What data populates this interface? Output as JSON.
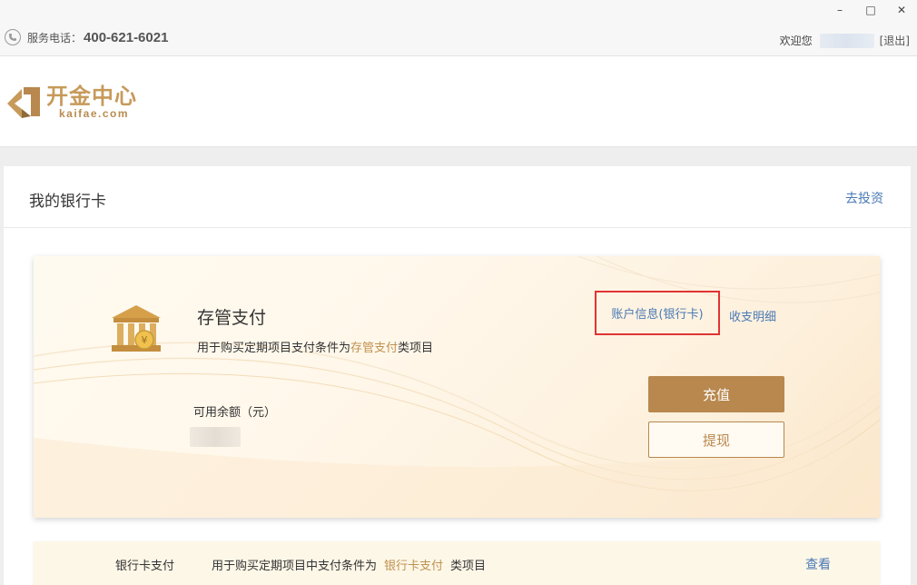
{
  "window": {
    "minimize": "–",
    "maximize": "□",
    "close": "✕"
  },
  "topbar": {
    "phone_label": "服务电话：",
    "phone_number": "400-621-6021",
    "welcome": "欢迎您",
    "logout": "[退出]"
  },
  "logo": {
    "name_cn": "开金中心",
    "name_en": "kaifae.com"
  },
  "panel": {
    "title": "我的银行卡",
    "go_invest": "去投资"
  },
  "card": {
    "title": "存管支付",
    "desc_prefix": "用于购买定期项目支付条件为",
    "desc_highlight": "存管支付",
    "desc_suffix": "类项目",
    "account_info_link": "账户信息(银行卡)",
    "detail_link": "收支明细",
    "balance_label": "可用余额（元）",
    "recharge_button": "充值",
    "withdraw_button": "提现"
  },
  "bank_row": {
    "type": "银行卡支付",
    "desc_prefix": "用于购买定期项目中支付条件为",
    "desc_highlight": "银行卡支付",
    "desc_suffix": "类项目",
    "view_link": "查看"
  },
  "colors": {
    "accent_gold": "#b8884e",
    "link_blue": "#4a7ab5",
    "highlight_red": "#e03434"
  }
}
